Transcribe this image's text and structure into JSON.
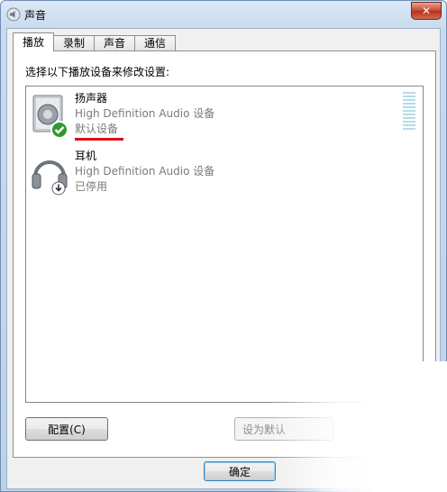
{
  "window": {
    "title": "声音",
    "close_glyph": "✕"
  },
  "tabs": [
    {
      "label": "播放",
      "active": true
    },
    {
      "label": "录制",
      "active": false
    },
    {
      "label": "声音",
      "active": false
    },
    {
      "label": "通信",
      "active": false
    }
  ],
  "panel": {
    "instruction": "选择以下播放设备来修改设置:"
  },
  "devices": [
    {
      "name": "扬声器",
      "description": "High Definition Audio 设备",
      "status": "默认设备",
      "icon": "speaker-icon",
      "badge": "check-badge-icon"
    },
    {
      "name": "耳机",
      "description": "High Definition Audio 设备",
      "status": "已停用",
      "icon": "headphones-icon",
      "badge": "down-arrow-badge-icon"
    }
  ],
  "buttons": {
    "configure": "配置(C)",
    "set_default": "设为默认",
    "ok": "确定"
  },
  "colors": {
    "accent_red": "#d8101a",
    "check_green": "#2e9a2e",
    "desc_gray": "#7a7a7a"
  }
}
